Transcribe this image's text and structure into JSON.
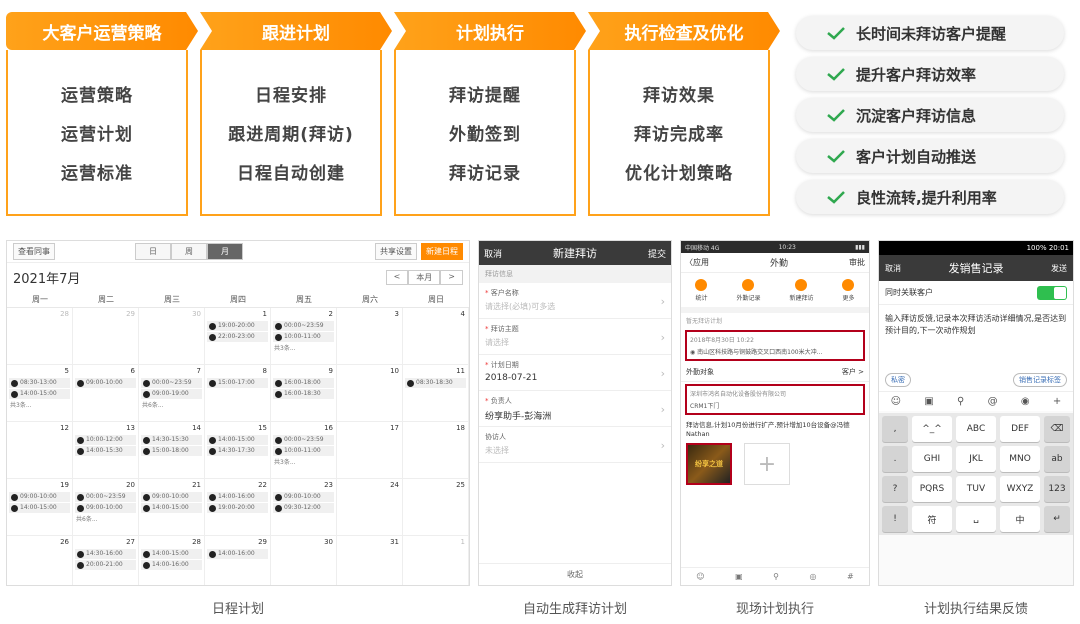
{
  "stages": [
    {
      "title": "大客户运营策略",
      "items": [
        "运营策略",
        "运营计划",
        "运营标准"
      ]
    },
    {
      "title": "跟进计划",
      "items": [
        "日程安排",
        "跟进周期(拜访)",
        "日程自动创建"
      ]
    },
    {
      "title": "计划执行",
      "items": [
        "拜访提醒",
        "外勤签到",
        "拜访记录"
      ]
    },
    {
      "title": "执行检查及优化",
      "items": [
        "拜访效果",
        "拜访完成率",
        "优化计划策略"
      ]
    }
  ],
  "benefits": [
    "长时间未拜访客户提醒",
    "提升客户拜访效率",
    "沉淀客户拜访信息",
    "客户计划自动推送",
    "良性流转,提升利用率"
  ],
  "colors": {
    "accent": "#ff8a00",
    "check": "#2fa84f",
    "highlight": "#b3001b"
  },
  "calendar": {
    "view_label": "查看同事",
    "views": [
      "日",
      "周",
      "月"
    ],
    "share_label": "共享设置",
    "new_label": "新建日程",
    "month_title": "2021年7月",
    "nav": [
      "<",
      "本月",
      ">"
    ],
    "weekdays": [
      "周一",
      "周二",
      "周三",
      "周四",
      "周五",
      "周六",
      "周日"
    ],
    "days": [
      {
        "n": "28",
        "mute": true,
        "ev": []
      },
      {
        "n": "29",
        "mute": true,
        "ev": []
      },
      {
        "n": "30",
        "mute": true,
        "ev": []
      },
      {
        "n": "1",
        "ev": [
          "19:00-20:00",
          "22:00-23:00"
        ]
      },
      {
        "n": "2",
        "ev": [
          "00:00~23:59",
          "10:00-11:00"
        ],
        "more": "共3条..."
      },
      {
        "n": "3",
        "ev": []
      },
      {
        "n": "4",
        "ev": []
      },
      {
        "n": "5",
        "ev": [
          "08:30-13:00",
          "14:00-15:00"
        ],
        "more": "共3条..."
      },
      {
        "n": "6",
        "ev": [
          "09:00-10:00"
        ]
      },
      {
        "n": "7",
        "ev": [
          "00:00~23:59",
          "09:00-19:00"
        ],
        "more": "共6条..."
      },
      {
        "n": "8",
        "ev": [
          "15:00-17:00"
        ]
      },
      {
        "n": "9",
        "ev": [
          "16:00-18:00",
          "16:00-18:30"
        ]
      },
      {
        "n": "10",
        "ev": []
      },
      {
        "n": "11",
        "ev": [
          "08:30-18:30"
        ]
      },
      {
        "n": "12",
        "ev": []
      },
      {
        "n": "13",
        "ev": [
          "10:00-12:00",
          "14:00-15:30"
        ]
      },
      {
        "n": "14",
        "ev": [
          "14:30-15:30",
          "15:00-18:00"
        ]
      },
      {
        "n": "15",
        "ev": [
          "14:00-15:00",
          "14:30-17:30"
        ]
      },
      {
        "n": "16",
        "ev": [
          "00:00~23:59",
          "10:00-11:00"
        ],
        "more": "共3条..."
      },
      {
        "n": "17",
        "ev": []
      },
      {
        "n": "18",
        "ev": []
      },
      {
        "n": "19",
        "ev": [
          "09:00-10:00",
          "14:00-15:00"
        ]
      },
      {
        "n": "20",
        "ev": [
          "00:00~23:59",
          "09:00-10:00"
        ],
        "more": "共6条..."
      },
      {
        "n": "21",
        "ev": [
          "09:00-10:00",
          "14:00-15:00"
        ]
      },
      {
        "n": "22",
        "ev": [
          "14:00-16:00",
          "19:00-20:00"
        ]
      },
      {
        "n": "23",
        "ev": [
          "09:00-10:00",
          "09:30-12:00"
        ]
      },
      {
        "n": "24",
        "ev": []
      },
      {
        "n": "25",
        "ev": []
      },
      {
        "n": "26",
        "ev": []
      },
      {
        "n": "27",
        "ev": [
          "14:30-16:00",
          "20:00-21:00"
        ]
      },
      {
        "n": "28",
        "ev": [
          "14:00-15:00",
          "14:00-16:00"
        ]
      },
      {
        "n": "29",
        "ev": [
          "14:00-16:00"
        ]
      },
      {
        "n": "30",
        "ev": []
      },
      {
        "n": "31",
        "ev": []
      },
      {
        "n": "1",
        "mute": true,
        "ev": []
      }
    ]
  },
  "form": {
    "cancel": "取消",
    "title": "新建拜访",
    "submit": "提交",
    "section": "拜访信息",
    "fields": [
      {
        "label": "客户名称",
        "req": true,
        "ph": "请选择(必填)可多选"
      },
      {
        "label": "拜访主题",
        "req": true,
        "ph": "请选择"
      },
      {
        "label": "计划日期",
        "req": true,
        "val": "2018-07-21"
      },
      {
        "label": "负责人",
        "req": true,
        "val": "纷享助手-彭海洲"
      },
      {
        "label": "协访人",
        "req": false,
        "ph": "未选择"
      }
    ],
    "footer": "收起"
  },
  "fieldexec": {
    "status_left": "中国移动 4G",
    "status_time": "10:23",
    "back": "〈应用",
    "title": "外勤",
    "right": "审批",
    "tools": [
      "统计",
      "外勤记录",
      "新建拜访",
      "更多"
    ],
    "section": "暂无拜访计划",
    "box1_line1": "2018年8月30日 10:22",
    "box1_line2": "南山区科技路与铜鼓路交叉口西南100米大冲...",
    "target_label": "外勤对象",
    "target_right": "客户 >",
    "box2_line1": "深圳市鸿名自动化设备股份有限公司",
    "box2_line2": "CRM1下门",
    "note": "拜访信息,计划10月份进行扩产,预计增加10台设备@冯德Nathan",
    "pic_text": "纷享之道",
    "bottom_icons": [
      "☺",
      "▣",
      "⚲",
      "◎",
      "#"
    ]
  },
  "feedback": {
    "status": "100% 20:01",
    "cancel": "取消",
    "title": "发销售记录",
    "send": "发送",
    "related": "同时关联客户",
    "text": "输入拜访反馈,记录本次拜访活动详细情况,是否达到预计目的,下一次动作规划",
    "private": "私密",
    "tag": "销售记录标签",
    "keys": [
      ",",
      "^_^",
      "ABC",
      "DEF",
      "⌫",
      ".",
      "GHI",
      "JKL",
      "MNO",
      "ab",
      "?",
      "PQRS",
      "TUV",
      "WXYZ",
      "123",
      "!",
      "符",
      "␣",
      "中",
      "↵"
    ]
  },
  "captions": [
    "日程计划",
    "自动生成拜访计划",
    "现场计划执行",
    "计划执行结果反馈"
  ]
}
